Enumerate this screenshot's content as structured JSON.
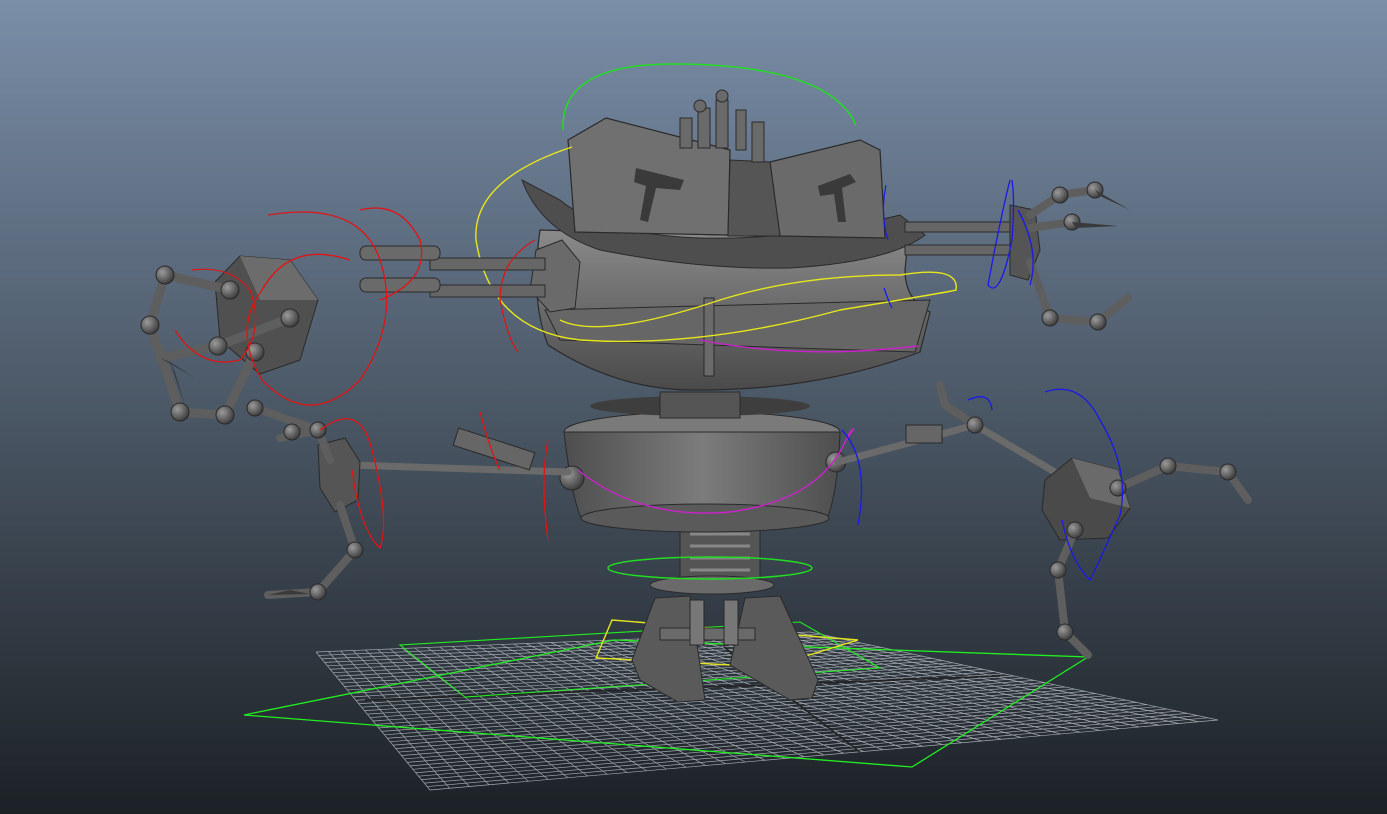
{
  "viewport": {
    "kind": "3d-perspective-viewport",
    "background_top": "#7a8ea8",
    "background_bottom": "#1c2126",
    "grid_color": "#b9bec4",
    "grid_axis_color": "#222222"
  },
  "model": {
    "mesh_color": "#6e6e6e",
    "mesh_dark": "#3c3c3c",
    "mesh_light": "#8a8a8a"
  },
  "controls": {
    "head_ctrl_color": "#22dd22",
    "torso_ctrl_color": "#e6e61e",
    "left_arm_ctrl_color": "#e01414",
    "right_arm_ctrl_color": "#1a1ae8",
    "waist_ctrl_color": "#cc22cc",
    "base_ctrl_color": "#22dd22",
    "foot_ctrl_color": "#e6e61e",
    "world_ctrl_color": "#22ee22"
  }
}
